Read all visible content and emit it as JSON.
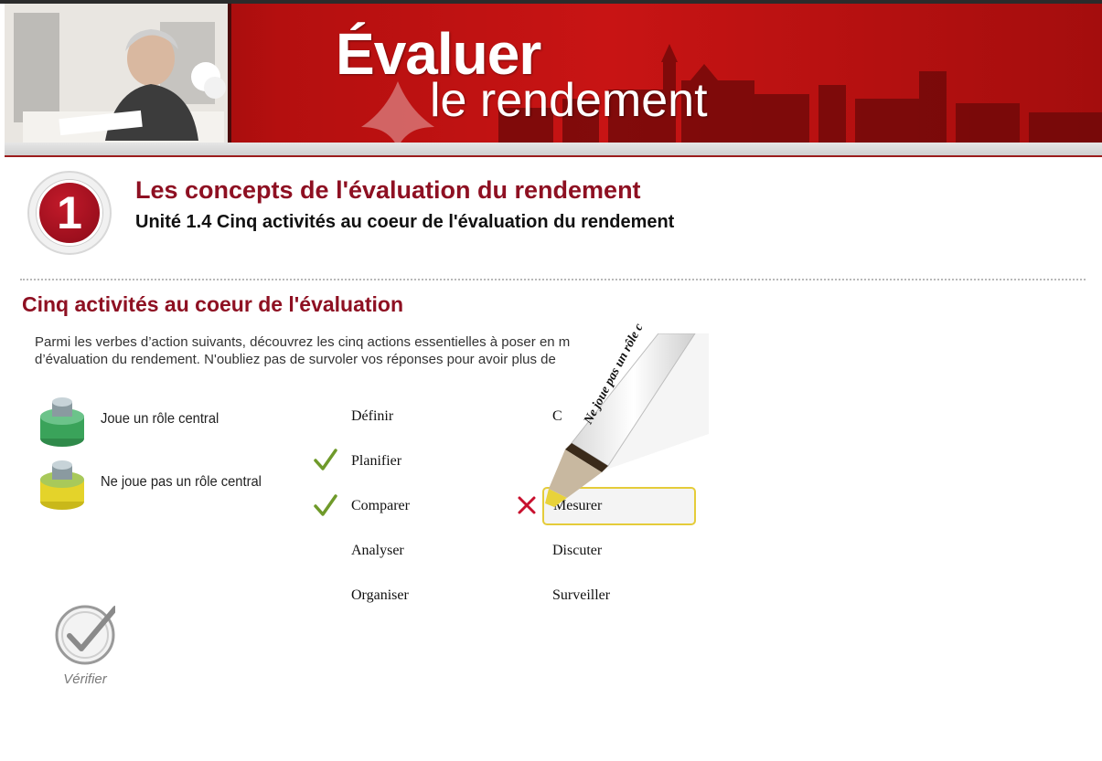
{
  "banner": {
    "title_line1": "Évaluer",
    "title_line2": "le rendement"
  },
  "module": {
    "number": "1",
    "title": "Les concepts de l'évaluation du rendement",
    "unit": "Unité 1.4 Cinq activités au coeur de l'évaluation du rendement"
  },
  "section": {
    "title": "Cinq activités au coeur de l'évaluation",
    "instructions": "Parmi les verbes d’action suivants, découvrez les cinq actions essentielles à poser en m\nd’évaluation du rendement. N'oubliez pas de survoler vos réponses pour avoir plus de"
  },
  "legend": {
    "central": "Joue un rôle central",
    "not_central": "Ne joue pas un rôle central"
  },
  "words": {
    "col1": [
      "Définir",
      "Planifier",
      "Comparer",
      "Analyser",
      "Organiser"
    ],
    "col2": [
      "C",
      "",
      "Mesurer",
      "Discuter",
      "Surveiller"
    ]
  },
  "tooltip": {
    "pen_text": "Ne joue pas un rôle c"
  },
  "verify": {
    "label": "Vérifier"
  },
  "colors": {
    "brand_red": "#8e1022",
    "highlight_yellow": "#f8f0c0",
    "highlight_green": "#c6dec6",
    "check_green": "#6f9a2a",
    "cross_red": "#c8102e"
  }
}
